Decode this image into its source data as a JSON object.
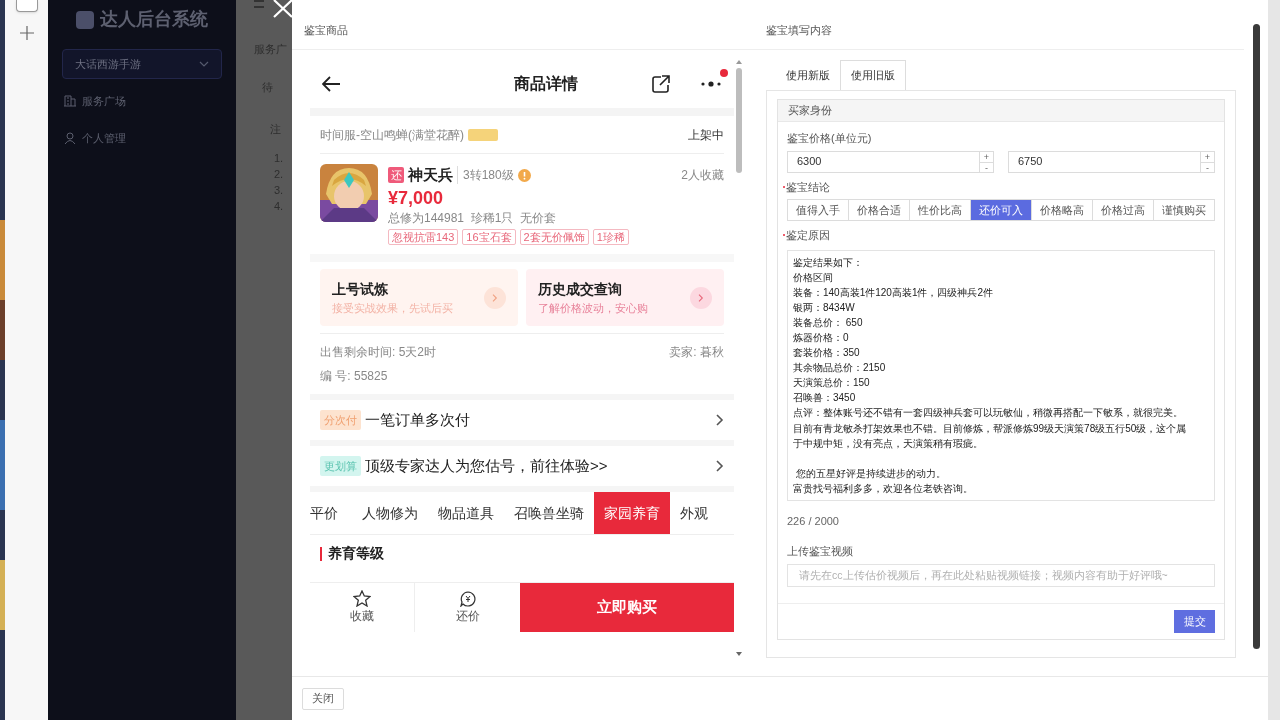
{
  "sidebar": {
    "title": "达人后台系统",
    "game_select": {
      "value": "大话西游手游"
    },
    "items": [
      {
        "label": "服务广场"
      },
      {
        "label": "个人管理"
      }
    ]
  },
  "background_page": {
    "breadcrumb": "服务广",
    "tab": "待",
    "notice": "注",
    "list_numbers": [
      "1.",
      "2.",
      "3.",
      "4."
    ]
  },
  "modal": {
    "left_title": "鉴宝商品",
    "right_title": "鉴宝填写内容",
    "close_button": "关闭"
  },
  "product": {
    "title": "商品详情",
    "has_notification": true,
    "server": "时间服-空山鸣蝉(满堂花醉)",
    "status": "上架中",
    "badge": "还",
    "name": "神天兵",
    "level": "3转180级",
    "favorites": "2人收藏",
    "price": "¥7,000",
    "summary": "总修为144981  珍稀1只  无价套",
    "tags": [
      "忽视抗雷143",
      "16宝石套",
      "2套无价佩饰",
      "1珍稀"
    ],
    "cards": [
      {
        "title": "上号试炼",
        "subtitle": "接受实战效果，先试后买"
      },
      {
        "title": "历史成交查询",
        "subtitle": "了解价格波动，安心购"
      }
    ],
    "remaining": "出售剩余时间: 5天2时",
    "seller": "卖家: 暮秋",
    "number": "编 号: 55825",
    "promos": [
      {
        "badge": "分次付",
        "text": "一笔订单多次付",
        "color": "#fde3cf"
      },
      {
        "badge": "更划算",
        "text": "顶级专家达人为您估号，前往体验>>",
        "color": "#d3f5ef"
      }
    ],
    "tabs": [
      {
        "label": "平价",
        "selected": false
      },
      {
        "label": "人物修为",
        "selected": false
      },
      {
        "label": "物品道具",
        "selected": false
      },
      {
        "label": "召唤兽坐骑",
        "selected": false
      },
      {
        "label": "家园养育",
        "selected": true
      },
      {
        "label": "外观",
        "selected": false
      }
    ],
    "section_title": "养育等级",
    "actions": [
      {
        "label": "收藏"
      },
      {
        "label": "还价"
      }
    ],
    "buy_button": "立即购买"
  },
  "appraisal": {
    "tabs": [
      {
        "label": "使用新版",
        "selected": false
      },
      {
        "label": "使用旧版",
        "selected": true
      }
    ],
    "panel_title": "买家身份",
    "price_label": "鉴宝价格(单位元)",
    "price_min": "6300",
    "price_max": "6750",
    "spin_up": "+",
    "spin_down": "-",
    "conclusion_label": "鉴宝结论",
    "conclusions": [
      {
        "label": "值得入手",
        "selected": false
      },
      {
        "label": "价格合适",
        "selected": false
      },
      {
        "label": "性价比高",
        "selected": false
      },
      {
        "label": "还价可入",
        "selected": true
      },
      {
        "label": "价格略高",
        "selected": false
      },
      {
        "label": "价格过高",
        "selected": false
      },
      {
        "label": "谨慎购买",
        "selected": false
      }
    ],
    "reason_label": "鉴定原因",
    "reason_lines": [
      "鉴定结果如下：",
      "价格区间",
      "装备：140高装1件120高装1件，四级神兵2件",
      "银两：8434W",
      "装备总价： 650",
      "炼器价格：0",
      "套装价格：350",
      "其余物品总价：2150",
      "天演策总价：150",
      "召唤兽：3450",
      "点评：整体账号还不错有一套四级神兵套可以玩敏仙，稍微再搭配一下敏系，就很完美。",
      "目前有青龙敏杀打架效果也不错。目前修炼，帮派修炼99级天演策78级五行50级，这个属",
      "于中规中矩，没有亮点，天演策稍有瑕疵。"
    ],
    "reason_closing_lines": [
      " 您的五星好评是持续进步的动力。",
      "富贵找号福利多多，欢迎各位老铁咨询。"
    ],
    "counter": "226 / 2000",
    "video_label": "上传鉴宝视频",
    "video_placeholder": "请先在cc上传估价视频后，再在此处粘贴视频链接；视频内容有助于好评哦~",
    "submit_button": "提交"
  }
}
